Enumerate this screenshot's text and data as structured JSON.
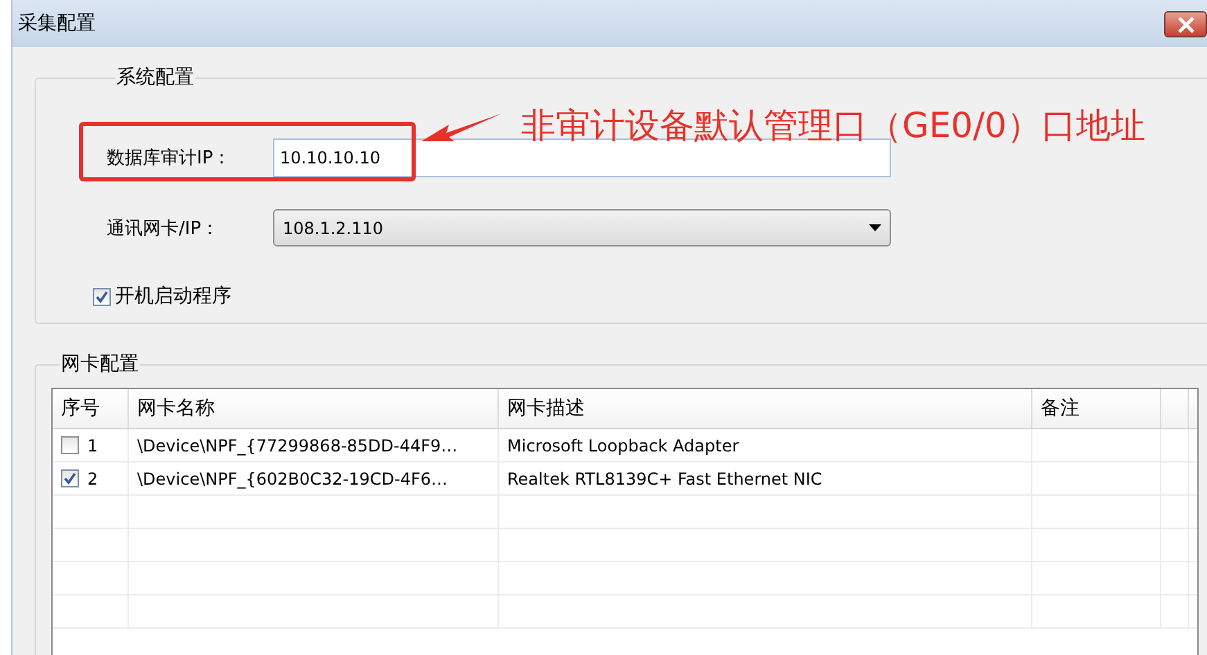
{
  "window": {
    "title": "采集配置"
  },
  "system_group": {
    "title": "系统配置",
    "db_audit_ip": {
      "label": "数据库审计IP：",
      "value": "10.10.10.10"
    },
    "nic_ip": {
      "label": "通讯网卡/IP：",
      "value": "108.1.2.110"
    },
    "autostart": {
      "label": "开机启动程序",
      "checked": true
    }
  },
  "annotation": {
    "text": "非审计设备默认管理口（GE0/0）口地址"
  },
  "nic_group": {
    "title": "网卡配置",
    "table": {
      "columns": [
        "序号",
        "网卡名称",
        "网卡描述",
        "备注"
      ],
      "rows": [
        {
          "checked": false,
          "index": "1",
          "name": "\\Device\\NPF_{77299868-85DD-44F9…",
          "description": "Microsoft Loopback Adapter"
        },
        {
          "checked": true,
          "index": "2",
          "name": "\\Device\\NPF_{602B0C32-19CD-4F6…",
          "description": "Realtek RTL8139C+ Fast Ethernet NIC"
        }
      ]
    }
  }
}
